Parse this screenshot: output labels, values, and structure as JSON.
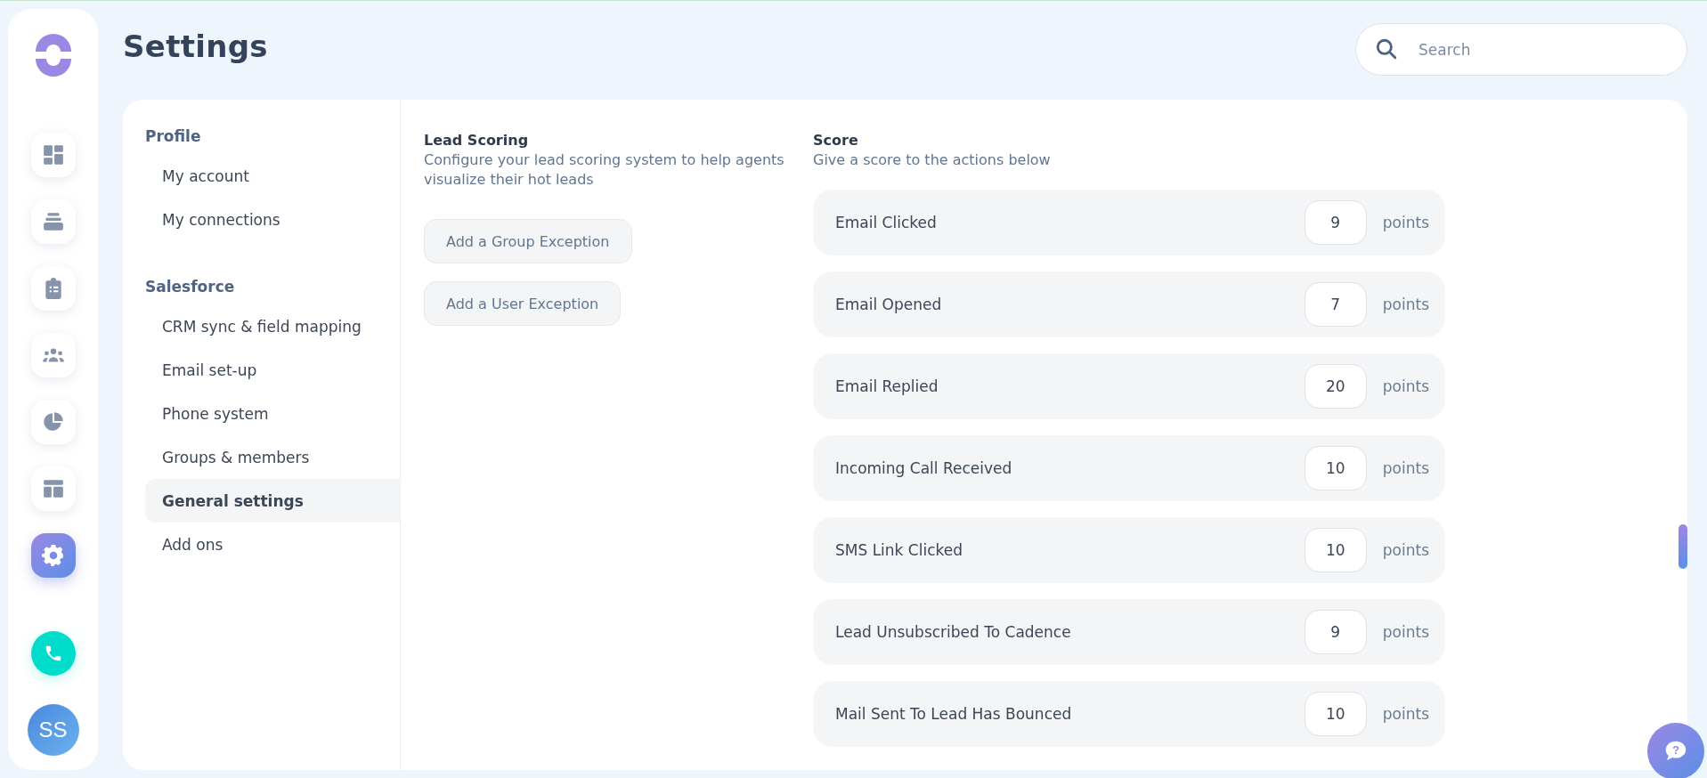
{
  "rail": [
    {
      "selected": false
    },
    {
      "selected": false
    },
    {
      "selected": false
    },
    {
      "selected": false
    },
    {
      "selected": false
    },
    {
      "selected": false
    },
    {
      "selected": true
    }
  ],
  "avatar": {
    "initials": "SS"
  },
  "help": {
    "icon": "?"
  },
  "page": {
    "title": "Settings"
  },
  "search": {
    "placeholder": "Search"
  },
  "nav": [
    {
      "heading": "Profile",
      "items": [
        {
          "label": "My account",
          "selected": false
        },
        {
          "label": "My connections",
          "selected": false
        }
      ]
    },
    {
      "heading": "Salesforce",
      "items": [
        {
          "label": "CRM sync & field mapping",
          "selected": false
        },
        {
          "label": "Email set-up",
          "selected": false
        },
        {
          "label": "Phone system",
          "selected": false
        },
        {
          "label": "Groups & members",
          "selected": false
        },
        {
          "label": "General settings",
          "selected": true
        },
        {
          "label": "Add ons",
          "selected": false
        }
      ]
    }
  ],
  "lead_scoring": {
    "title": "Lead Scoring",
    "description": "Configure your lead scoring system to help agents visualize their hot leads",
    "buttons": [
      "Add a Group Exception",
      "Add a User Exception"
    ]
  },
  "score": {
    "title": "Score",
    "subtitle": "Give a score to the actions below",
    "rows": [
      {
        "action": "Email Clicked",
        "value": "9",
        "unit": "points"
      },
      {
        "action": "Email Opened",
        "value": "7",
        "unit": "points"
      },
      {
        "action": "Email Replied",
        "value": "20",
        "unit": "points"
      },
      {
        "action": "Incoming Call Received",
        "value": "10",
        "unit": "points"
      },
      {
        "action": "SMS Link Clicked",
        "value": "10",
        "unit": "points"
      },
      {
        "action": "Lead Unsubscribed To Cadence",
        "value": "9",
        "unit": "points"
      },
      {
        "action": "Mail Sent To Lead Has Bounced",
        "value": "10",
        "unit": "points"
      }
    ]
  }
}
